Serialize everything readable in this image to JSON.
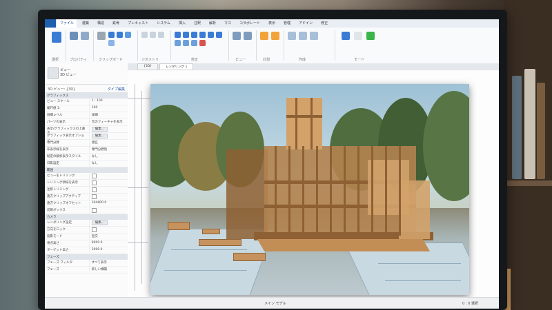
{
  "ribbon": {
    "tabs": [
      "ファイル",
      "建築",
      "構造",
      "鉄骨",
      "プレキャスト",
      "システム",
      "挿入",
      "注釈",
      "解析",
      "マス",
      "コラボレート",
      "表示",
      "管理",
      "アドイン",
      "修正"
    ],
    "groups": [
      "選択",
      "プロパティ",
      "クリップボード",
      "ジオメトリ",
      "修正",
      "ビュー",
      "計測",
      "作成",
      "モード"
    ],
    "colors": {
      "accent": "#1e5fae",
      "tool_blue": "#3a7bd5",
      "tool_orange": "#f2a33a",
      "tool_green": "#39b54a"
    }
  },
  "properties": {
    "type_name": "ビュー",
    "type_sub": "3D ビュー",
    "selector": "3D ビュー: {3D}",
    "edit_type": "タイプ編集",
    "sections": [
      {
        "title": "グラフィックス",
        "rows": [
          {
            "k": "ビュー スケール",
            "v": "1 : 100"
          },
          {
            "k": "縮尺値 1:",
            "v": "100"
          },
          {
            "k": "詳細レベル",
            "v": "詳細"
          },
          {
            "k": "パーツの表示",
            "v": "元のフィーチャを表示"
          },
          {
            "k": "表示/グラフィックスの上書き",
            "v": "編集..."
          },
          {
            "k": "グラフィック表示オプション",
            "v": "編集..."
          },
          {
            "k": "専門分野",
            "v": "意匠"
          },
          {
            "k": "非表示線を表示",
            "v": "専門分野別"
          },
          {
            "k": "既定の解析表示スタイル",
            "v": "なし"
          },
          {
            "k": "日影設定",
            "v": "なし"
          }
        ]
      },
      {
        "title": "範囲",
        "rows": [
          {
            "k": "ビューをトリミング",
            "v": ""
          },
          {
            "k": "トリミング領域を表示",
            "v": ""
          },
          {
            "k": "注釈トリミング",
            "v": ""
          },
          {
            "k": "遠方クリップアクティブ",
            "v": ""
          },
          {
            "k": "遠方クリップオフセット",
            "v": "304800.0"
          },
          {
            "k": "切断ボックス",
            "v": ""
          }
        ]
      },
      {
        "title": "カメラ",
        "rows": [
          {
            "k": "レンダリング設定",
            "v": "編集..."
          },
          {
            "k": "方向をロック",
            "v": ""
          },
          {
            "k": "投影モード",
            "v": "直交"
          },
          {
            "k": "視点高さ",
            "v": "8000.0"
          },
          {
            "k": "ターゲット高さ",
            "v": "3000.0"
          }
        ]
      },
      {
        "title": "フェーズ",
        "rows": [
          {
            "k": "フェーズ フィルタ",
            "v": "すべて表示"
          },
          {
            "k": "フェーズ",
            "v": "新しい構築"
          }
        ]
      }
    ]
  },
  "view_tabs": [
    "{3D}",
    "レンダリング 1"
  ],
  "status": {
    "left": "",
    "mid": "メイン モデル",
    "right": "0 : 0 選択"
  }
}
